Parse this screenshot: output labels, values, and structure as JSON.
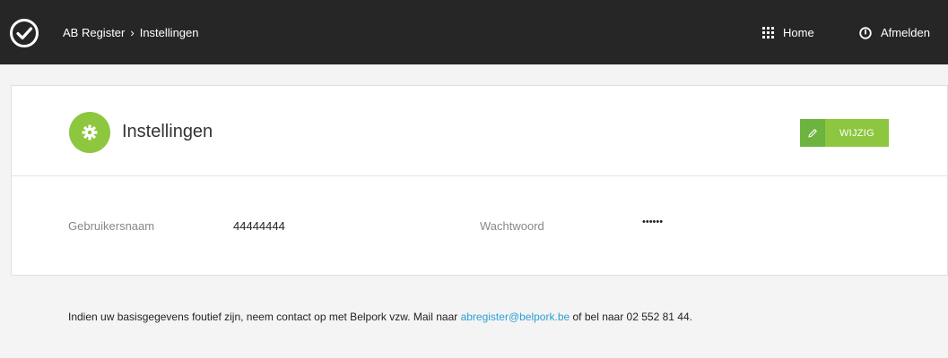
{
  "topbar": {
    "breadcrumb": [
      "AB Register",
      "Instellingen"
    ],
    "breadcrumb_separator": "›",
    "home_label": "Home",
    "logout_label": "Afmelden"
  },
  "settings": {
    "title": "Instellingen",
    "edit_label": "WIJZIG",
    "username_label": "Gebruikersnaam",
    "username_value": "44444444",
    "password_label": "Wachtwoord",
    "password_value": "••••••"
  },
  "notice": {
    "text_before": "Indien uw basisgegevens foutief zijn, neem contact op met Belpork vzw. Mail naar ",
    "email": "abregister@belpork.be",
    "text_after": " of bel naar 02 552 81 44."
  },
  "colors": {
    "topbar": "#262626",
    "accent_green": "#8dc63f",
    "link_blue": "#2a9fd6"
  }
}
